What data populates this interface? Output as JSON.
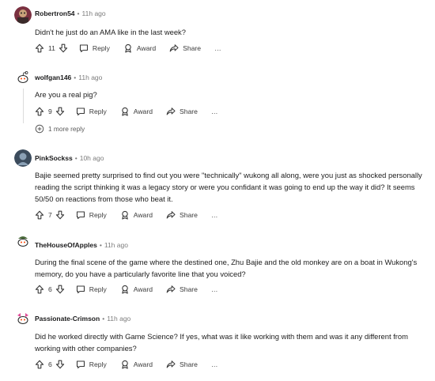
{
  "comments": [
    {
      "user": "Robertron54",
      "time": "11h ago",
      "text": "Didn't he just do an AMA like in the last week?",
      "votes": "11",
      "reply": "Reply",
      "award": "Award",
      "share": "Share",
      "more": "…"
    },
    {
      "user": "wolfgan146",
      "time": "11h ago",
      "text": "Are you a real pig?",
      "votes": "9",
      "reply": "Reply",
      "award": "Award",
      "share": "Share",
      "more": "…",
      "more_replies": "1 more reply"
    },
    {
      "user": "PinkSockss",
      "time": "10h ago",
      "text": "Bajie seemed pretty surprised to find out you were \"technically\" wukong all along, were you just as shocked personally reading the script thinking it was a legacy story or were you confidant it was going to end up the way it did? It seems 50/50 on reactions from those who beat it.",
      "votes": "7",
      "reply": "Reply",
      "award": "Award",
      "share": "Share",
      "more": "…"
    },
    {
      "user": "TheHouseOfApples",
      "time": "11h ago",
      "text": "During the final scene of the game where the destined one, Zhu Bajie and the old monkey are on a boat in Wukong's memory, do you have a particularly favorite line that you voiced?",
      "votes": "6",
      "reply": "Reply",
      "award": "Award",
      "share": "Share",
      "more": "…"
    },
    {
      "user": "Passionate-Crimson",
      "time": "11h ago",
      "text": "Did he worked directly with Game Science? If yes, what was it like working with them and was it any different from working with other companies?",
      "votes": "6",
      "reply": "Reply",
      "award": "Award",
      "share": "Share",
      "more": "…"
    }
  ],
  "separator": "•"
}
